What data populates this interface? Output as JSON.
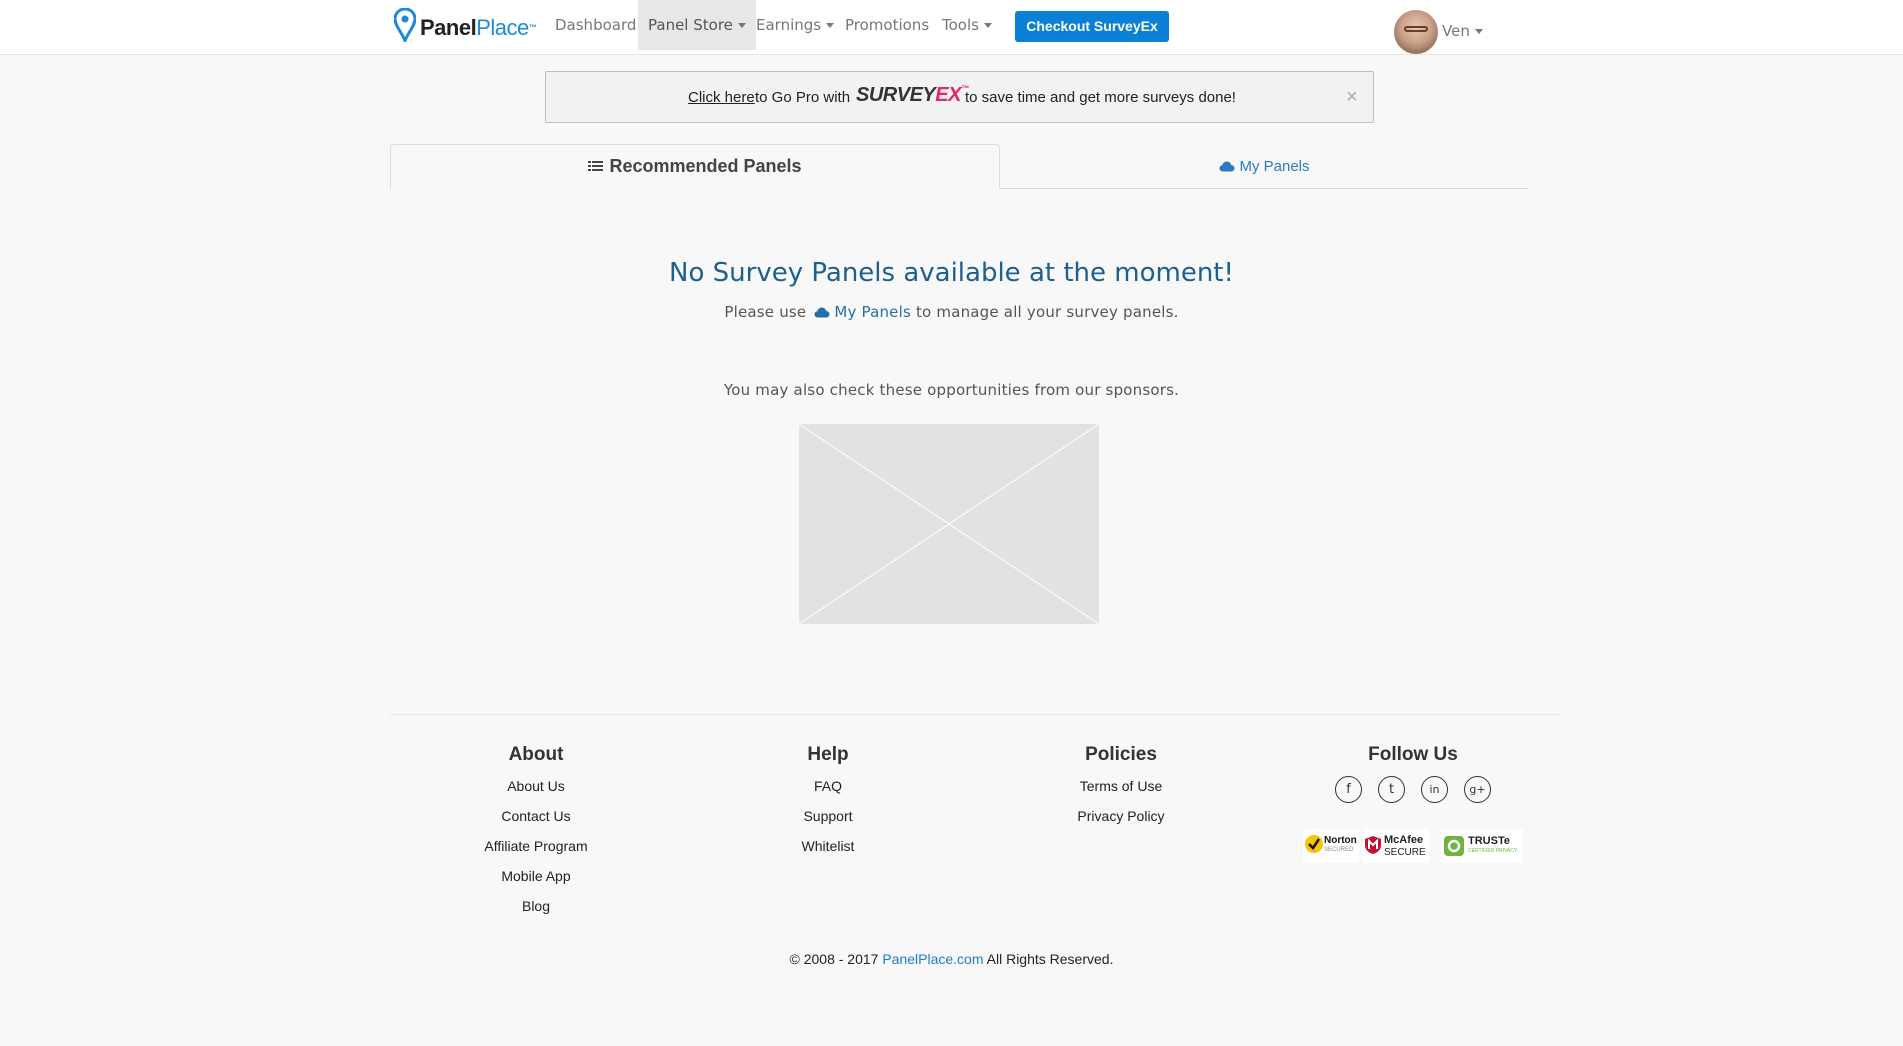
{
  "brand": {
    "logo_part1": "Panel",
    "logo_part2": "Place",
    "logo_tm": "™"
  },
  "nav": {
    "items": [
      {
        "label": "Dashboard",
        "dropdown": false,
        "active": false
      },
      {
        "label": "Panel Store",
        "dropdown": true,
        "active": true
      },
      {
        "label": "Earnings",
        "dropdown": true,
        "active": false
      },
      {
        "label": "Promotions",
        "dropdown": false,
        "active": false
      },
      {
        "label": "Tools",
        "dropdown": true,
        "active": false
      }
    ],
    "cta_label": "Checkout SurveyEx",
    "user_name": "Ven"
  },
  "promo": {
    "link_text": "Click here",
    "text_before_logo": "to Go Pro with",
    "logo_part1": "SURVEY",
    "logo_part2": "EX",
    "logo_tm": "™",
    "text_after_logo": "to save time and get more surveys done!",
    "close_symbol": "×"
  },
  "tabs": [
    {
      "label": "Recommended Panels",
      "icon": "list-icon",
      "active": true
    },
    {
      "label": "My Panels",
      "icon": "cloud-icon",
      "active": false
    }
  ],
  "main": {
    "heading": "No Survey Panels available at the moment!",
    "sub_before": "Please use",
    "sub_link": "My Panels",
    "sub_after": "to manage all your survey panels.",
    "sponsor_text": "You may also check these opportunities from our sponsors."
  },
  "footer": {
    "about": {
      "title": "About",
      "links": [
        "About Us",
        "Contact Us",
        "Affiliate Program",
        "Mobile App",
        "Blog"
      ]
    },
    "help": {
      "title": "Help",
      "links": [
        "FAQ",
        "Support",
        "Whitelist"
      ]
    },
    "policies": {
      "title": "Policies",
      "links": [
        "Terms of Use",
        "Privacy Policy"
      ]
    },
    "follow": {
      "title": "Follow Us",
      "social": [
        {
          "name": "facebook",
          "glyph": "f"
        },
        {
          "name": "twitter",
          "glyph": "t"
        },
        {
          "name": "linkedin",
          "glyph": "in"
        },
        {
          "name": "google-plus",
          "glyph": "g+"
        }
      ]
    },
    "badges": [
      {
        "name": "Norton",
        "sub": "SECURED"
      },
      {
        "name": "McAfee",
        "sub": "SECURE"
      },
      {
        "name": "TRUSTe",
        "sub": "CERTIFIED PRIVACY"
      }
    ],
    "copyright_before": "© 2008 - 2017",
    "copyright_link": "PanelPlace.com",
    "copyright_after": "All Rights Reserved."
  },
  "colors": {
    "brand_blue": "#1c8ad8",
    "cta_blue": "#0a80d6",
    "heading_blue": "#1d5f8f",
    "surveyex_pink": "#e5246b"
  }
}
